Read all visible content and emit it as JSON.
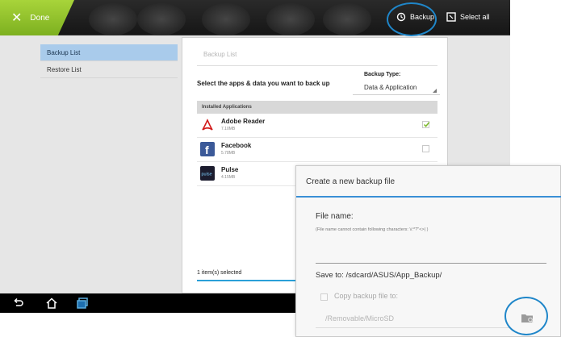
{
  "topbar": {
    "done_label": "Done",
    "backup_label": "Backup",
    "select_all_label": "Select all"
  },
  "sidebar": {
    "items": [
      {
        "label": "Backup List",
        "active": true
      },
      {
        "label": "Restore List",
        "active": false
      }
    ]
  },
  "main": {
    "title": "Backup List",
    "select_text": "Select the apps & data you want to back up",
    "backup_type_label": "Backup Type:",
    "backup_type_value": "Data & Application",
    "installed_header": "Installed Applications",
    "apps": [
      {
        "name": "Adobe Reader",
        "size": "7.10MB",
        "checked": true,
        "icon": "adobe-reader-icon"
      },
      {
        "name": "Facebook",
        "size": "5.78MB",
        "checked": false,
        "icon": "facebook-icon"
      },
      {
        "name": "Pulse",
        "size": "4.15MB",
        "checked": false,
        "icon": "pulse-icon"
      }
    ],
    "selected_count_text": "1 item(s) selected"
  },
  "dialog": {
    "title": "Create a new backup file",
    "file_name_label": "File name:",
    "file_name_hint": "(File name cannot contain following characters: \\/:*?\"<>| )",
    "file_name_value": "",
    "save_to": "Save to:  /sdcard/ASUS/App_Backup/",
    "copy_label": "Copy backup file to:",
    "copy_checked": false,
    "copy_path": "/Removable/MicroSD"
  },
  "colors": {
    "accent_green": "#8cc63f",
    "highlight_blue": "#1f86c9",
    "selected_item": "#a9cbeb",
    "dialog_divider": "#3a8fd6"
  }
}
